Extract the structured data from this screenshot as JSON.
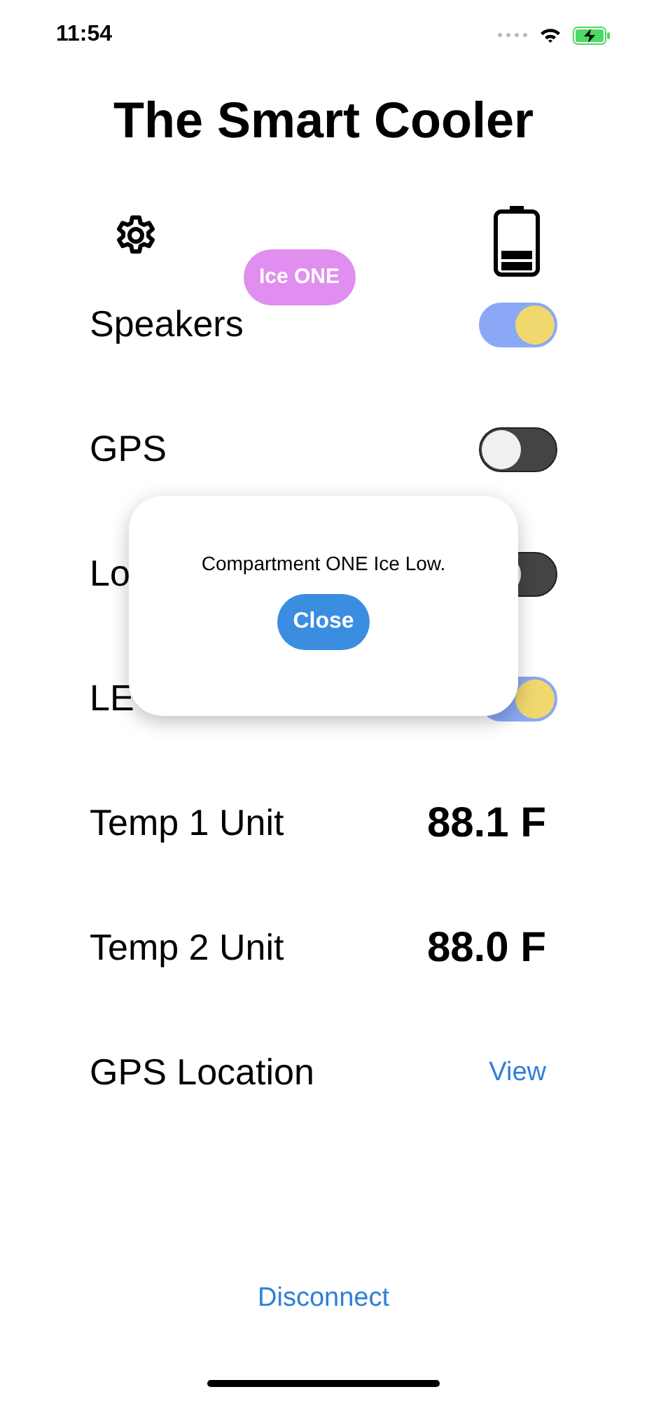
{
  "status_bar": {
    "time": "11:54"
  },
  "title": "The Smart Cooler",
  "badge": "Ice ONE",
  "settings": [
    {
      "kind": "toggle",
      "label": "Speakers",
      "on": true
    },
    {
      "kind": "toggle",
      "label": "GPS",
      "on": false
    },
    {
      "kind": "toggle",
      "label": "Lo",
      "on": false
    },
    {
      "kind": "toggle",
      "label": "LE",
      "on": true
    },
    {
      "kind": "reading",
      "label": "Temp 1 Unit",
      "value": "88.1 F"
    },
    {
      "kind": "reading",
      "label": "Temp 2 Unit",
      "value": "88.0 F"
    },
    {
      "kind": "link",
      "label": "GPS Location",
      "value": "View"
    }
  ],
  "alert": {
    "message": "Compartment ONE Ice Low.",
    "button": "Close"
  },
  "disconnect": "Disconnect"
}
